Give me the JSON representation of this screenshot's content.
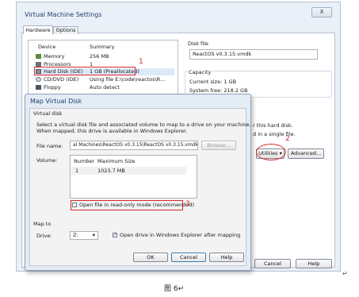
{
  "vm_window": {
    "title": "Virtual Machine Settings",
    "tabs": [
      "Hardware",
      "Options"
    ],
    "device_header": "Device",
    "summary_header": "Summary",
    "devices": [
      {
        "name": "Memory",
        "summary": "256 MB",
        "icon": "memory-icon"
      },
      {
        "name": "Processors",
        "summary": "1",
        "icon": "cpu-icon"
      },
      {
        "name": "Hard Disk (IDE)",
        "summary": "1 GB (Preallocated)",
        "icon": "hard-disk-icon"
      },
      {
        "name": "CD/DVD (IDE)",
        "summary": "Using file E:\\code\\reactos\\R...",
        "icon": "cd-icon"
      },
      {
        "name": "Floppy",
        "summary": "Auto detect",
        "icon": "floppy-icon"
      }
    ],
    "disk_file_label": "Disk file",
    "disk_file_value": "ReactOS v0.3.15.vmdk",
    "capacity_label": "Capacity",
    "current_size": "Current size: 1 GB",
    "system_free": "System free: 218.2 GB",
    "info_line1": "r this hard disk.",
    "info_line2": "d in a single file.",
    "utilities_label": "Utilities",
    "advanced_label": "Advanced...",
    "cancel_label": "Cancel",
    "help_label": "Help",
    "close_label": "X"
  },
  "dialog": {
    "title": "Map Virtual Disk",
    "section_virtual_disk": "Virtual disk",
    "description_line1": "Select a virtual disk file and associated volume to map to a drive on your machine.",
    "description_line2": "When mapped, this drive is available in Windows Explorer.",
    "file_name_label": "File name:",
    "file_name_value": "al Machines\\ReactOS v0.3.15\\ReactOS v0.3.15.vmdk",
    "browse_label": "Browse...",
    "volume_label": "Volume:",
    "volume_columns": [
      "Number",
      "Maximum Size"
    ],
    "volumes": [
      {
        "number": "1",
        "size": "1023.7 MB"
      }
    ],
    "readonly_label": "Open file in read-only mode (recommended)",
    "readonly_checked": false,
    "section_map_to": "Map to",
    "drive_label": "Drive:",
    "drive_value": "Z:",
    "open_explorer_label": "Open drive in Windows Explorer after mapping",
    "open_explorer_checked": true,
    "ok_label": "OK",
    "cancel_label": "Cancel",
    "help_label": "Help"
  },
  "annotations": {
    "n1": "1",
    "n2": "2",
    "n3": "3"
  },
  "caption": "图 6↵",
  "corner_mark": "↵",
  "colors": {
    "annotation_red": "#d9262c",
    "title_blue": "#1f3f6e",
    "selection_blue": "#dce9f8"
  }
}
